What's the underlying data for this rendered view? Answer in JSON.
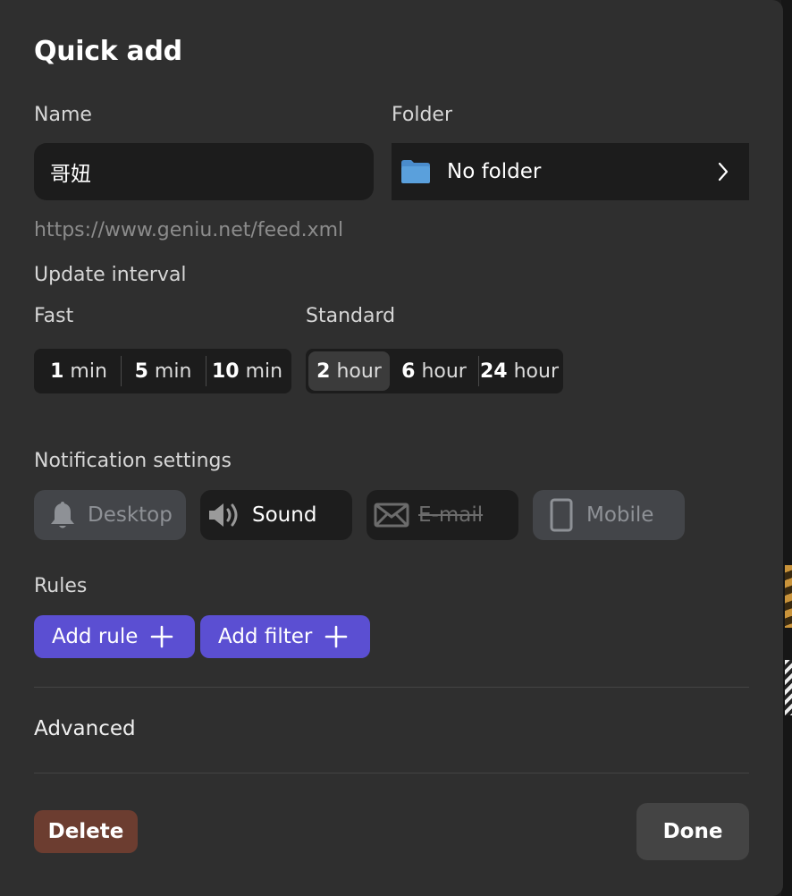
{
  "dialog": {
    "title": "Quick add",
    "name_label": "Name",
    "name_value": "哥妞",
    "folder_label": "Folder",
    "folder_value": "No folder",
    "feed_url": "https://www.geniu.net/feed.xml",
    "update_interval_label": "Update interval",
    "fast_label": "Fast",
    "standard_label": "Standard",
    "fast_options": [
      {
        "num": "1",
        "unit": "min"
      },
      {
        "num": "5",
        "unit": "min"
      },
      {
        "num": "10",
        "unit": "min"
      }
    ],
    "standard_options": [
      {
        "num": "2",
        "unit": "hour"
      },
      {
        "num": "6",
        "unit": "hour"
      },
      {
        "num": "24",
        "unit": "hour"
      }
    ],
    "selected_interval": "2 hour",
    "notification_label": "Notification settings",
    "notifications": [
      {
        "label": "Desktop",
        "icon": "bell-icon",
        "state": "off"
      },
      {
        "label": "Sound",
        "icon": "speaker-icon",
        "state": "on"
      },
      {
        "label": "E-mail",
        "icon": "mail-icon",
        "state": "disabled"
      },
      {
        "label": "Mobile",
        "icon": "phone-icon",
        "state": "off"
      }
    ],
    "rules_label": "Rules",
    "add_rule_label": "Add rule",
    "add_filter_label": "Add filter",
    "advanced_label": "Advanced",
    "delete_label": "Delete",
    "done_label": "Done"
  },
  "colors": {
    "panel": "#2f2f2f",
    "field": "#1c1c1c",
    "accent": "#5b4fd2",
    "danger": "#6c3d30",
    "folder_icon": "#5aa0dc"
  }
}
